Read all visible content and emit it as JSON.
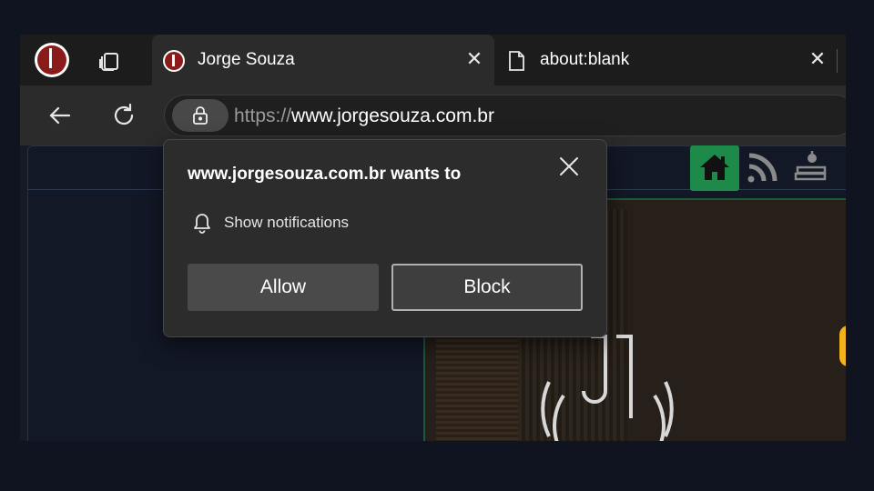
{
  "tabs": [
    {
      "title": "Jorge Souza",
      "favicon": "site-logo-icon",
      "active": true
    },
    {
      "title": "about:blank",
      "favicon": "page-icon",
      "active": false
    }
  ],
  "toolbar": {
    "back_icon": "back-arrow-icon",
    "refresh_icon": "refresh-icon",
    "lock_icon": "lock-icon",
    "url_scheme": "https://",
    "url_host": "www.jorgesouza.com.br"
  },
  "site_nav": {
    "icons": [
      "home-icon",
      "rss-icon",
      "books-icon"
    ],
    "accent": "#1e8a4a"
  },
  "permission_popup": {
    "heading": "www.jorgesouza.com.br wants to",
    "permission_icon": "bell-icon",
    "permission": "Show notifications",
    "allow_label": "Allow",
    "block_label": "Block"
  },
  "colors": {
    "background": "#0f1420",
    "popup_bg": "#2c2c2c",
    "brand_red": "#8b1a1a",
    "brand_gold": "#f2b21b"
  }
}
